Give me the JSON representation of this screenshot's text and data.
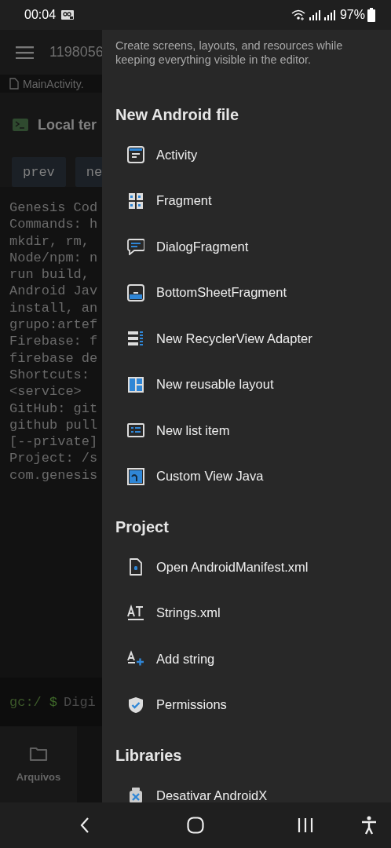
{
  "status_bar": {
    "time": "00:04",
    "battery": "97%"
  },
  "background_app": {
    "title": "1198056",
    "file_tab": "MainActivity.",
    "terminal_title": "Local ter",
    "buttons": [
      "prev",
      "ne"
    ],
    "terminal_lines": [
      "Genesis Cod",
      "Commands: h",
      "mkdir, rm,",
      "Node/npm: n",
      "run build,",
      "Android Jav",
      "install, an",
      "grupo:artef",
      "Firebase: f",
      "firebase de",
      "Shortcuts:",
      "<service>",
      "GitHub: git",
      "github pull",
      "[--private]",
      "Project: /s",
      "com.genesis"
    ],
    "prompt": {
      "path": "gc:/",
      "symbol": "$",
      "placeholder": "Digi"
    },
    "bottom_nav": [
      {
        "label": "Arquivos"
      }
    ]
  },
  "drawer": {
    "subtitle": "Create screens, layouts, and resources while keeping everything visible in the editor.",
    "sections": [
      {
        "title": "New Android file",
        "items": [
          {
            "label": "Activity"
          },
          {
            "label": "Fragment"
          },
          {
            "label": "DialogFragment"
          },
          {
            "label": "BottomSheetFragment"
          },
          {
            "label": "New RecyclerView Adapter"
          },
          {
            "label": "New reusable layout"
          },
          {
            "label": "New list item"
          },
          {
            "label": "Custom View Java"
          }
        ]
      },
      {
        "title": "Project",
        "items": [
          {
            "label": "Open AndroidManifest.xml"
          },
          {
            "label": "Strings.xml"
          },
          {
            "label": "Add string"
          },
          {
            "label": "Permissions"
          }
        ]
      },
      {
        "title": "Libraries",
        "items": [
          {
            "label": "Desativar AndroidX"
          }
        ]
      }
    ]
  }
}
